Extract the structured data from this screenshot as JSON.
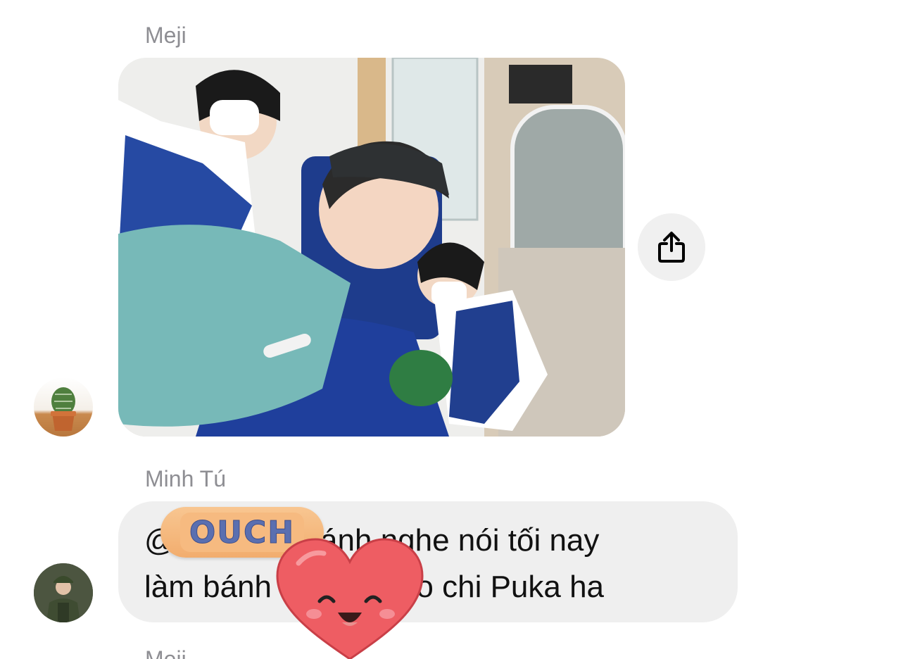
{
  "messages": [
    {
      "sender": "Meji",
      "type": "photo",
      "avatar": "cactus-avatar"
    },
    {
      "sender": "Minh Tú",
      "type": "text",
      "text": "@             khánh nghe nói tối nay\nlàm bánh             cho chi Puka ha",
      "avatar": "soldier-avatar",
      "stickers": [
        "OUCH",
        "heart-smile"
      ]
    },
    {
      "sender": "Meji"
    }
  ],
  "icons": {
    "share": "share-icon"
  },
  "colors": {
    "bubble": "#efefef",
    "name": "#8e8e93",
    "share_bg": "#f0f0f0"
  }
}
